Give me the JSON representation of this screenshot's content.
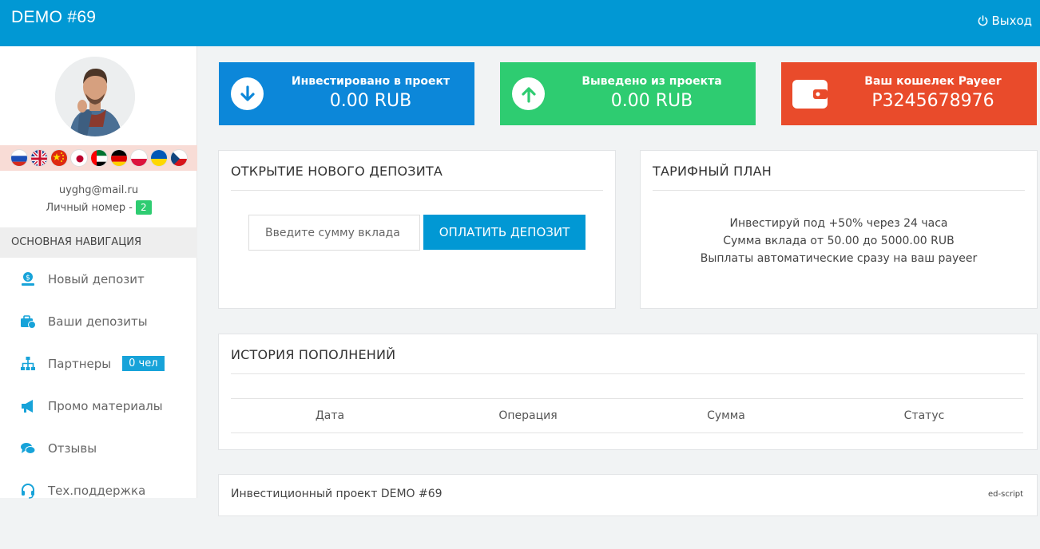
{
  "header": {
    "brand": "DEMO #69",
    "logout_label": "Выход",
    "color": "#0198d4"
  },
  "sidebar": {
    "avatar": "avatar",
    "flags": [
      "ru",
      "gb",
      "cn",
      "jp",
      "ae",
      "de",
      "pl",
      "ua",
      "cz"
    ],
    "email": "uyghg@mail.ru",
    "personal_number_label": "Личный номер -",
    "personal_number": "2",
    "nav_header": "ОСНОВНАЯ НАВИГАЦИЯ",
    "items": [
      {
        "label": "Новый депозит",
        "icon": "money-hand-icon"
      },
      {
        "label": "Ваши депозиты",
        "icon": "briefcase-clock-icon"
      },
      {
        "label": "Партнеры",
        "icon": "sitemap-icon",
        "badge": "0 чел"
      },
      {
        "label": "Промо материалы",
        "icon": "megaphone-icon"
      },
      {
        "label": "Отзывы",
        "icon": "comments-icon"
      },
      {
        "label": "Тех.поддержка",
        "icon": "headset-icon"
      }
    ]
  },
  "cards": [
    {
      "label": "Инвестировано в проект",
      "value": "0.00 RUB",
      "color": "#0c87d9",
      "icon": "arrow-down-circle-icon"
    },
    {
      "label": "Выведено из проекта",
      "value": "0.00 RUB",
      "color": "#2ecc71",
      "icon": "arrow-up-circle-icon"
    },
    {
      "label": "Ваш кошелек Payeer",
      "value": "P3245678976",
      "color": "#e94b2b",
      "icon": "wallet-icon"
    }
  ],
  "deposit": {
    "title": "ОТКРЫТИЕ НОВОГО ДЕПОЗИТА",
    "placeholder": "Введите сумму вклада",
    "button": "ОПЛАТИТЬ ДЕПОЗИТ"
  },
  "tariff": {
    "title": "ТАРИФНЫЙ ПЛАН",
    "lines": [
      "Инвестируй под +50% через 24 часа",
      "Сумма вклада от 50.00 до 5000.00 RUB",
      "Выплаты автоматические сразу на ваш payeer"
    ]
  },
  "history": {
    "title": "ИСТОРИЯ ПОПОЛНЕНИЙ",
    "columns": [
      "Дата",
      "Операция",
      "Сумма",
      "Статус"
    ]
  },
  "footer": {
    "text": "Инвестиционный проект DEMO #69",
    "credit": "ed-script"
  }
}
